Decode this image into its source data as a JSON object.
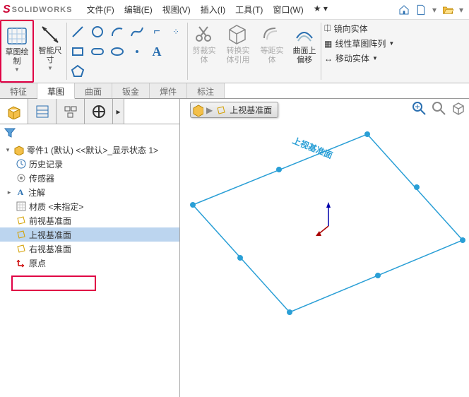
{
  "app": {
    "name": "SOLIDWORKS"
  },
  "menus": {
    "file": "文件(F)",
    "edit": "编辑(E)",
    "view": "视图(V)",
    "insert": "插入(I)",
    "tools": "工具(T)",
    "window": "窗口(W)"
  },
  "ribbon": {
    "sketch": "草图绘\n制",
    "smartdim": "智能尺\n寸",
    "trim": "剪裁实\n体",
    "convert": "转换实\n体引用",
    "offset_ent": "等距实\n体",
    "offset_surf": "曲面上\n偏移",
    "mirror": "镜向实体",
    "linear": "线性草图阵列",
    "move": "移动实体"
  },
  "tabs": {
    "feature": "特征",
    "sketch": "草图",
    "surface": "曲面",
    "sheetmetal": "钣金",
    "weldment": "焊件",
    "annotate": "标注"
  },
  "tree": {
    "root": "零件1 (默认) <<默认>_显示状态 1>",
    "history": "历史记录",
    "sensors": "传感器",
    "annotations": "注解",
    "material": "材质 <未指定>",
    "front": "前视基准面",
    "top": "上视基准面",
    "right": "右视基准面",
    "origin": "原点"
  },
  "canvas": {
    "tag": "上视基准面",
    "plane_label": "上视基准面"
  }
}
